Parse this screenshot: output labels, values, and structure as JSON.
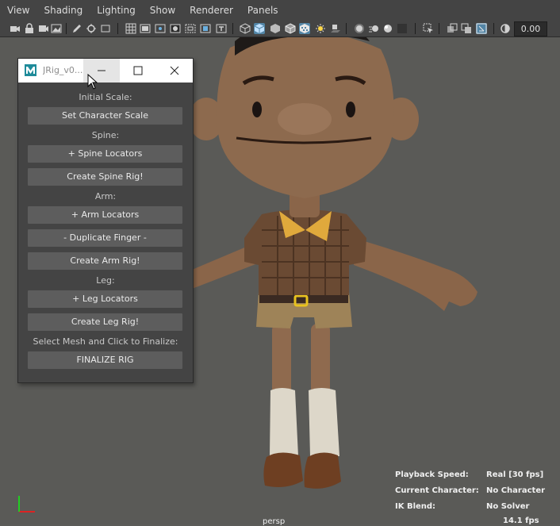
{
  "menu": [
    "View",
    "Shading",
    "Lighting",
    "Show",
    "Renderer",
    "Panels"
  ],
  "toolbar": {
    "exposure_value": "0.00"
  },
  "rig_window": {
    "title": "JRig_v0...",
    "sections": {
      "initial_scale": "Initial Scale:",
      "spine": "Spine:",
      "arm": "Arm:",
      "leg": "Leg:",
      "finalize": "Select Mesh and Click to Finalize:"
    },
    "buttons": {
      "set_scale": "Set Character Scale",
      "spine_locators": "+ Spine Locators",
      "create_spine": "Create Spine Rig!",
      "arm_locators": "+ Arm Locators",
      "duplicate_finger": "- Duplicate Finger -",
      "create_arm": "Create Arm Rig!",
      "leg_locators": "+ Leg Locators",
      "create_leg": "Create Leg Rig!",
      "finalize": "FINALIZE RIG"
    }
  },
  "hud": {
    "playback_label": "Playback Speed:",
    "playback_value": "Real [30 fps]",
    "character_label": "Current Character:",
    "character_value": "No Character",
    "ik_label": "IK Blend:",
    "ik_value": "No Solver",
    "camera_name": "persp",
    "fps": "14.1 fps"
  },
  "colors": {
    "ui_bg": "#444444",
    "viewport_bg": "#5a5a57",
    "button_bg": "#5d5d5d",
    "selected_icon": "#5285a6"
  }
}
